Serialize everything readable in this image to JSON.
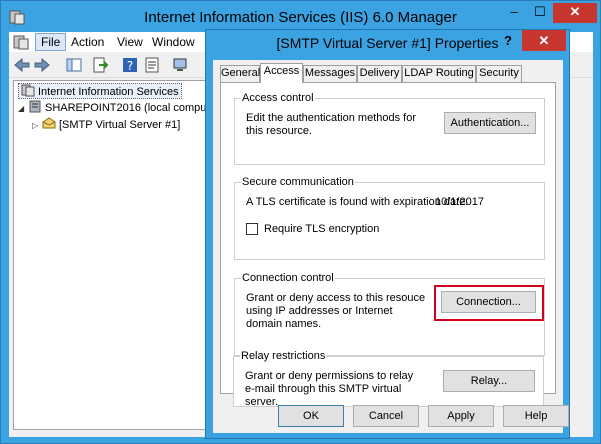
{
  "main_window": {
    "title": "Internet Information Services (IIS) 6.0 Manager",
    "controls": {
      "minimize": "–",
      "maximize": "☐",
      "close": "✕"
    }
  },
  "menubar": {
    "items": [
      "File",
      "Action",
      "View",
      "Window"
    ]
  },
  "toolbar": {
    "icons": [
      "back-icon",
      "forward-icon",
      "show-tree-icon",
      "export-icon",
      "help-icon",
      "properties-icon",
      "computer-icon"
    ]
  },
  "tree": {
    "root": "Internet Information Services",
    "server": "SHAREPOINT2016 (local compu",
    "smtp": "[SMTP Virtual Server #1]"
  },
  "dialog": {
    "title": "[SMTP Virtual Server #1] Properties",
    "help": "?",
    "close": "✕",
    "tabs": [
      "General",
      "Access",
      "Messages",
      "Delivery",
      "LDAP Routing",
      "Security"
    ],
    "active_tab": "Access",
    "access_control": {
      "label": "Access control",
      "text": "Edit the authentication methods for this resource.",
      "button": "Authentication..."
    },
    "secure_communication": {
      "label": "Secure communication",
      "text": "A TLS certificate is found with expiration date:",
      "date": "10/1/2017",
      "checkbox_label": "Require TLS encryption",
      "checkbox_checked": false
    },
    "connection_control": {
      "label": "Connection control",
      "text": "Grant or deny access to this resouce using IP addresses or Internet domain names.",
      "button": "Connection...",
      "highlight_color": "#d0021b"
    },
    "relay_restrictions": {
      "label": "Relay restrictions",
      "text": "Grant or deny permissions to relay e-mail through this SMTP virtual server.",
      "button": "Relay..."
    },
    "footer": {
      "ok": "OK",
      "cancel": "Cancel",
      "apply": "Apply",
      "help": "Help"
    }
  },
  "colors": {
    "title_bar": "#3ba3e2",
    "close_button": "#c7372f"
  }
}
